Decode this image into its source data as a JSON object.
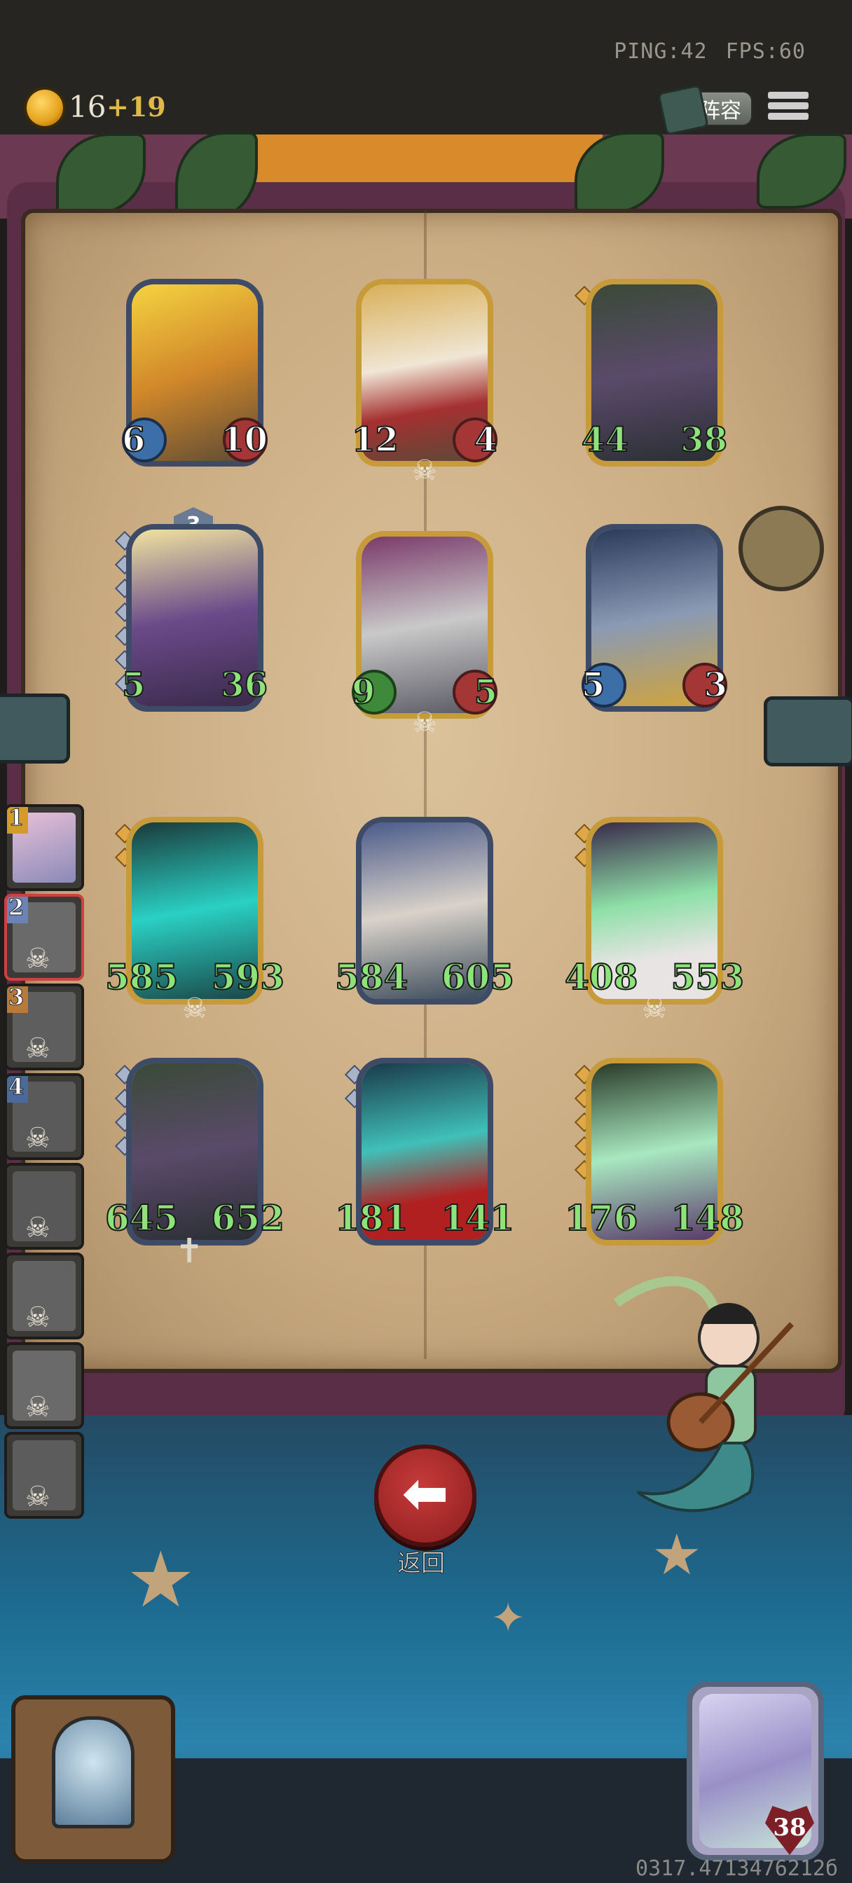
{
  "network": {
    "ping": "PING:42",
    "fps": "FPS:60"
  },
  "resources": {
    "gold": "16",
    "income": "+19"
  },
  "header": {
    "lineup_label": "阵容"
  },
  "board": {
    "row1": [
      {
        "atk": "6",
        "hp": "10",
        "art": "ogre-warrior"
      },
      {
        "atk": "12",
        "hp": "4",
        "art": "crusader-knight"
      },
      {
        "atk": "44",
        "hp": "38",
        "art": "plague-hunter"
      }
    ],
    "row2": [
      {
        "atk": "5",
        "hp": "36",
        "art": "golem-knight",
        "level": "3"
      },
      {
        "atk": "9",
        "hp": "5",
        "art": "hooded-knight"
      },
      {
        "atk": "5",
        "hp": "3",
        "art": "paladin"
      }
    ],
    "row3": [
      {
        "atk": "585",
        "hp": "593",
        "art": "spectral-wolf"
      },
      {
        "atk": "584",
        "hp": "605",
        "art": "wizard"
      },
      {
        "atk": "408",
        "hp": "553",
        "art": "ghost-bride"
      }
    ],
    "row4": [
      {
        "atk": "645",
        "hp": "652",
        "art": "plague-hunter"
      },
      {
        "atk": "181",
        "hp": "141",
        "art": "spirit-mage"
      },
      {
        "atk": "176",
        "hp": "148",
        "art": "ghost-cat"
      }
    ]
  },
  "sidebar": {
    "slots": [
      {
        "num": "1",
        "state": "alive"
      },
      {
        "num": "2",
        "state": "active"
      },
      {
        "num": "3",
        "state": "dead"
      },
      {
        "num": "4",
        "state": "dead"
      },
      {
        "num": "",
        "state": "dead"
      },
      {
        "num": "",
        "state": "dead"
      },
      {
        "num": "",
        "state": "dead"
      },
      {
        "num": "",
        "state": "dead"
      }
    ]
  },
  "back_button": {
    "label": "返回"
  },
  "hero": {
    "hp": "38"
  },
  "seed": "0317.4713476212б",
  "colors": {
    "atk_badge": "#3c6ea8",
    "hp_badge": "#a43636",
    "buffed_text": "#8ee27a"
  }
}
